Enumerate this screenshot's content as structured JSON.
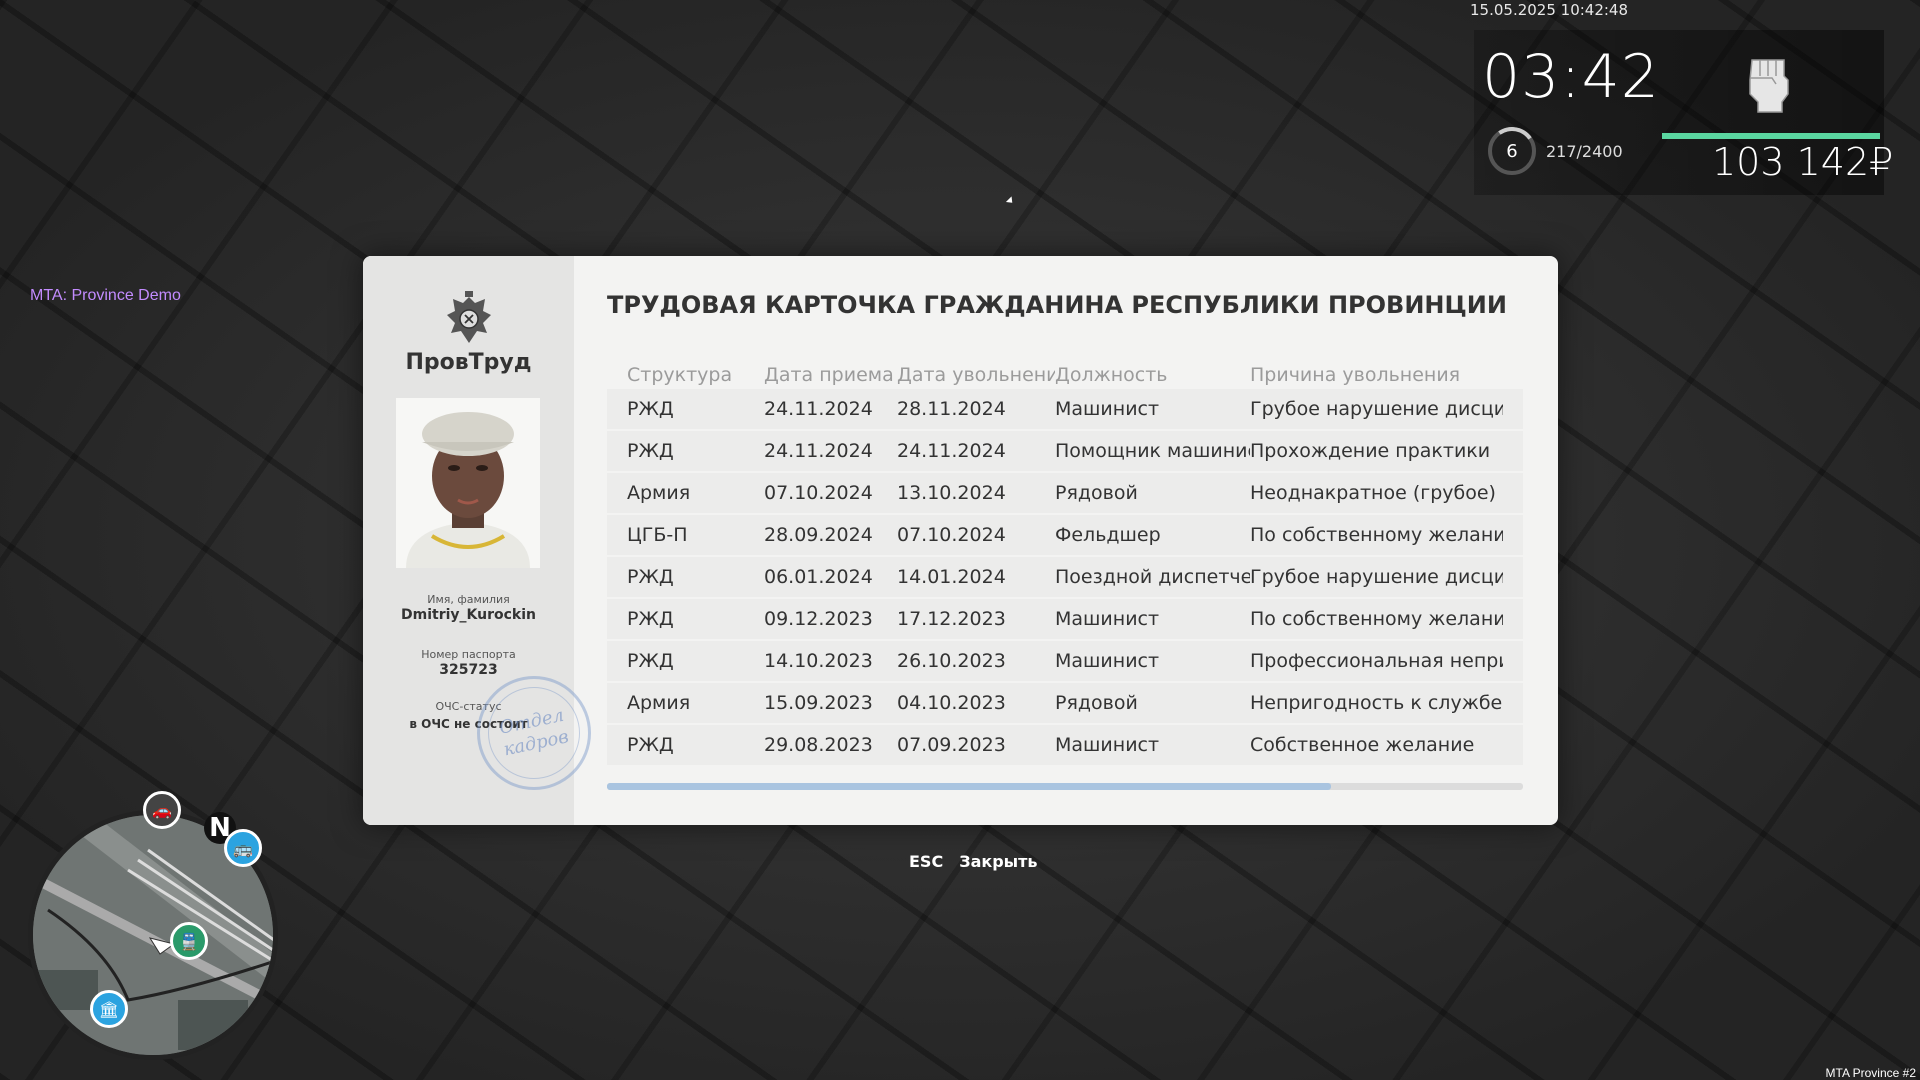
{
  "hud": {
    "datetime": "15.05.2025 10:42:48",
    "time": "03:42",
    "level": "6",
    "xp": "217/2400",
    "money": "103 142₽",
    "health_fraction": 1.0,
    "accent_color": "#5ad6a0"
  },
  "server_label": "MTA: Province Demo",
  "watermark": "MTA Province #2",
  "card": {
    "title": "ТРУДОВАЯ КАРТОЧКА ГРАЖДАНИНА РЕСПУБЛИКИ ПРОВИНЦИИ",
    "org_name": "ПровТруд",
    "name_label": "Имя, фамилия",
    "name_value": "Dmitriy_Kurockin",
    "passport_label": "Номер паспорта",
    "passport_value": "325723",
    "status_label": "ОЧС-статус",
    "status_value": "в ОЧС не состоит",
    "stamp_line1": "Отдел",
    "stamp_line2": "кадров",
    "columns": [
      "Структура",
      "Дата приема",
      "Дата увольнени",
      "Должность",
      "Причина увольнения"
    ],
    "rows": [
      [
        "РЖД",
        "24.11.2024",
        "28.11.2024",
        "Машинист",
        "Грубое нарушение дисциплин"
      ],
      [
        "РЖД",
        "24.11.2024",
        "24.11.2024",
        "Помощник машинис",
        "Прохождение практики"
      ],
      [
        "Армия",
        "07.10.2024",
        "13.10.2024",
        "Рядовой",
        "Неоднакратное (грубое) нар"
      ],
      [
        "ЦГБ-П",
        "28.09.2024",
        "07.10.2024",
        "Фельдшер",
        "По собственному желанию"
      ],
      [
        "РЖД",
        "06.01.2024",
        "14.01.2024",
        "Поездной диспетчер",
        "Грубое нарушение дисциплин"
      ],
      [
        "РЖД",
        "09.12.2023",
        "17.12.2023",
        "Машинист",
        "По собственному желанию"
      ],
      [
        "РЖД",
        "14.10.2023",
        "26.10.2023",
        "Машинист",
        "Профессиональная непригод"
      ],
      [
        "Армия",
        "15.09.2023",
        "04.10.2023",
        "Рядовой",
        "Непригодность к службе."
      ],
      [
        "РЖД",
        "29.08.2023",
        "07.09.2023",
        "Машинист",
        "Собственное желание"
      ]
    ],
    "scroll_fraction": 0.79
  },
  "close": {
    "key": "ESC",
    "label": "Закрыть"
  },
  "minimap": {
    "north": "N",
    "icons": [
      "car-icon",
      "bus-icon",
      "train-icon",
      "bank-icon"
    ]
  }
}
